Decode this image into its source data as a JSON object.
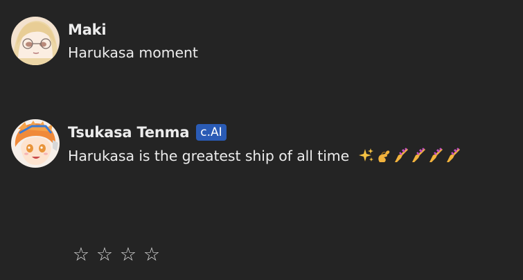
{
  "messages": [
    {
      "role": "user",
      "author": "Maki",
      "avatar_icon": "anime-girl-blonde-avatar",
      "text": "Harukasa moment"
    },
    {
      "role": "bot",
      "author": "Tsukasa Tenma",
      "badge": "c.AI",
      "badge_color": "#2a5bb5",
      "avatar_icon": "anime-boy-orange-hair-avatar",
      "text": "Harukasa is the greatest ship of all time",
      "emojis": [
        "sparkles",
        "pinching-hand",
        "nail-polish",
        "nail-polish",
        "nail-polish",
        "nail-polish"
      ]
    }
  ],
  "rating": {
    "stars": [
      "☆",
      "☆",
      "☆",
      "☆"
    ],
    "selected": 0
  },
  "colors": {
    "background": "#242424",
    "text": "#ececec"
  }
}
